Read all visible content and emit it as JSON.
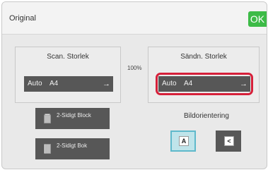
{
  "header": {
    "title": "Original",
    "ok_label": "OK"
  },
  "scan_size": {
    "title": "Scan. Storlek",
    "auto": "Auto",
    "paper": "A4"
  },
  "send_size": {
    "title": "Sändn. Storlek",
    "auto": "Auto",
    "paper": "A4"
  },
  "ratio": "100%",
  "duplex": {
    "block_label": "2-Sidigt Block",
    "bok_label": "2-Sidigt Bok"
  },
  "orientation": {
    "label": "Bildorientering",
    "portrait_glyph": "A",
    "landscape_glyph": "<",
    "selected": "portrait"
  },
  "colors": {
    "ok": "#3dbb47",
    "highlight": "#d6203a",
    "selected": "#bfe4ea"
  }
}
